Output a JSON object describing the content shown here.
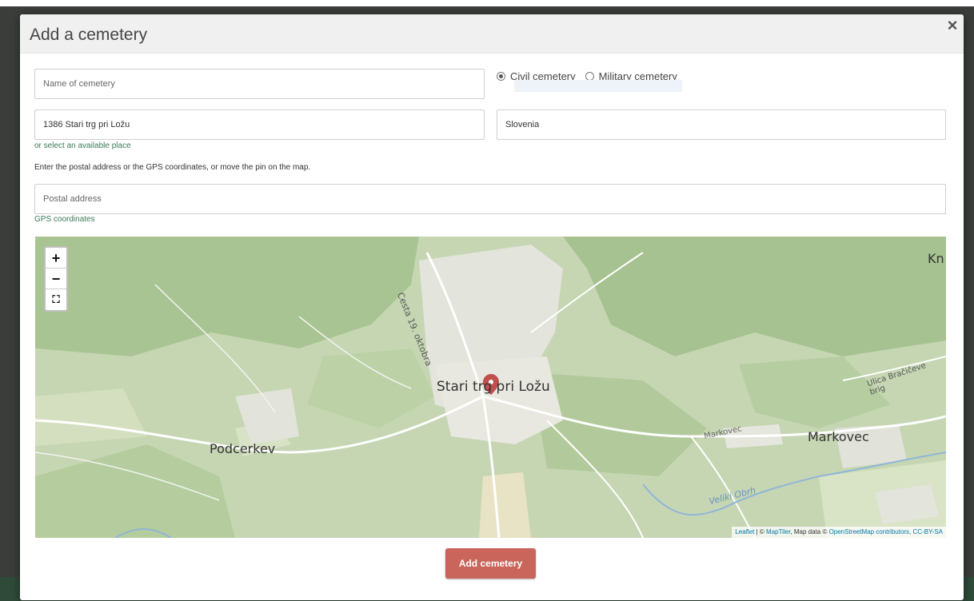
{
  "modal": {
    "title": "Add a cemetery",
    "close_label": "×"
  },
  "form": {
    "name_placeholder": "Name of cemetery",
    "cemetery_type_options": [
      {
        "label": "Civil cemetery",
        "checked": true
      },
      {
        "label": "Military cemetery",
        "checked": false
      }
    ],
    "place_value": "1386 Stari trg pri Ložu",
    "country_value": "Slovenia",
    "select_place_link": "or select an available place",
    "help_text": "Enter the postal address or the GPS coordinates, or move the pin on the map.",
    "postal_placeholder": "Postal address",
    "gps_link": "GPS coordinates",
    "submit_label": "Add cemetery"
  },
  "map": {
    "zoom_in": "+",
    "zoom_out": "−",
    "fullscreen": "⛶",
    "labels": {
      "town": "Stari trg pri Ložu",
      "podcerkev": "Podcerkev",
      "markovec": "Markovec",
      "markovec_small": "Markovec",
      "cesta": "Cesta 19. oktobra",
      "ulica": "Ulica Bračičeve brig",
      "veliki": "Veliki Obrh",
      "kn": "Kn"
    },
    "attribution": {
      "leaflet": "Leaflet",
      "sep1": " | © ",
      "maptiler": "MapTiler",
      "data": ", Map data © ",
      "osm": "OpenStreetMap contributors",
      "license": ", CC-BY-SA"
    }
  },
  "colors": {
    "accent": "#c9655b",
    "link": "#3b7a57",
    "pin": "#c0504d"
  }
}
